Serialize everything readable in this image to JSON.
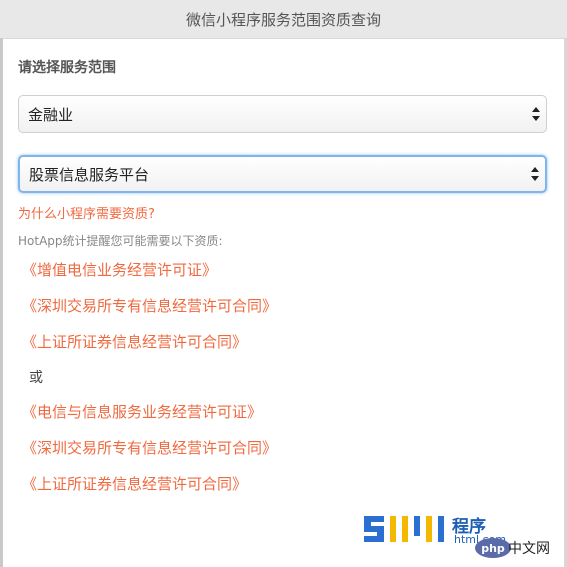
{
  "window": {
    "title": "微信小程序服务范围资质查询"
  },
  "form": {
    "section_label": "请选择服务范围",
    "industry_select": {
      "value": "金融业"
    },
    "service_select": {
      "value": "股票信息服务平台"
    }
  },
  "why_link": "为什么小程序需要资质?",
  "hint": "HotApp统计提醒您可能需要以下资质:",
  "licenses_group1": [
    "《增值电信业务经营许可证》",
    "《深圳交易所专有信息经营许可合同》",
    "《上证所证券信息经营许可合同》"
  ],
  "or_text": "或",
  "licenses_group2": [
    "《电信与信息服务业务经营许可证》",
    "《深圳交易所专有信息经营许可合同》",
    "《上证所证券信息经营许可合同》"
  ],
  "watermark": {
    "brand": "程序",
    "site": "html.com",
    "badge": "php",
    "cn": "中文网"
  },
  "colors": {
    "accent": "#f0693f",
    "focus": "#7fb5ec",
    "titlebar": "#e8e8e8"
  }
}
